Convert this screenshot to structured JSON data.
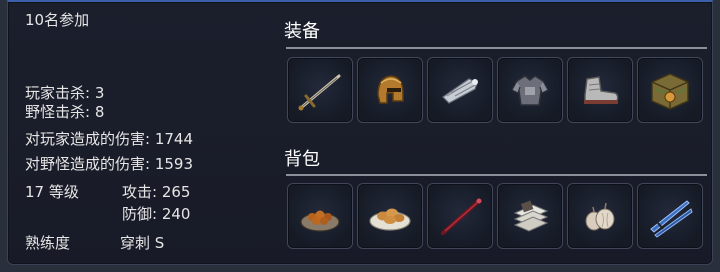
{
  "player": {
    "rank_text": "10名参加",
    "player_kills": "玩家击杀: 3",
    "monster_kills": "野怪击杀: 8",
    "damage_to_players": "对玩家造成的伤害: 1744",
    "damage_to_monsters": "对野怪造成的伤害: 1593",
    "level": "17 等级",
    "attack": "攻击: 265",
    "defense": "防御: 240",
    "proficiency_label": "熟练度",
    "proficiency_value": "穿刺 S"
  },
  "equipment": {
    "title": "装备",
    "items": [
      {
        "icon": "sword-icon"
      },
      {
        "icon": "helmet-icon"
      },
      {
        "icon": "gauntlet-icon"
      },
      {
        "icon": "armor-icon"
      },
      {
        "icon": "boots-icon"
      },
      {
        "icon": "crate-icon"
      }
    ]
  },
  "backpack": {
    "title": "背包",
    "items": [
      {
        "icon": "bowl-of-food-icon"
      },
      {
        "icon": "bread-plate-icon"
      },
      {
        "icon": "red-staff-icon"
      },
      {
        "icon": "paper-stack-icon"
      },
      {
        "icon": "garlic-icon"
      },
      {
        "icon": "twin-blades-icon"
      }
    ]
  },
  "colors": {
    "panel_bg": "#1a1e2b",
    "text": "#e6e6e6",
    "accent_top": "#3b5fa8",
    "divider": "#8c8f98"
  }
}
